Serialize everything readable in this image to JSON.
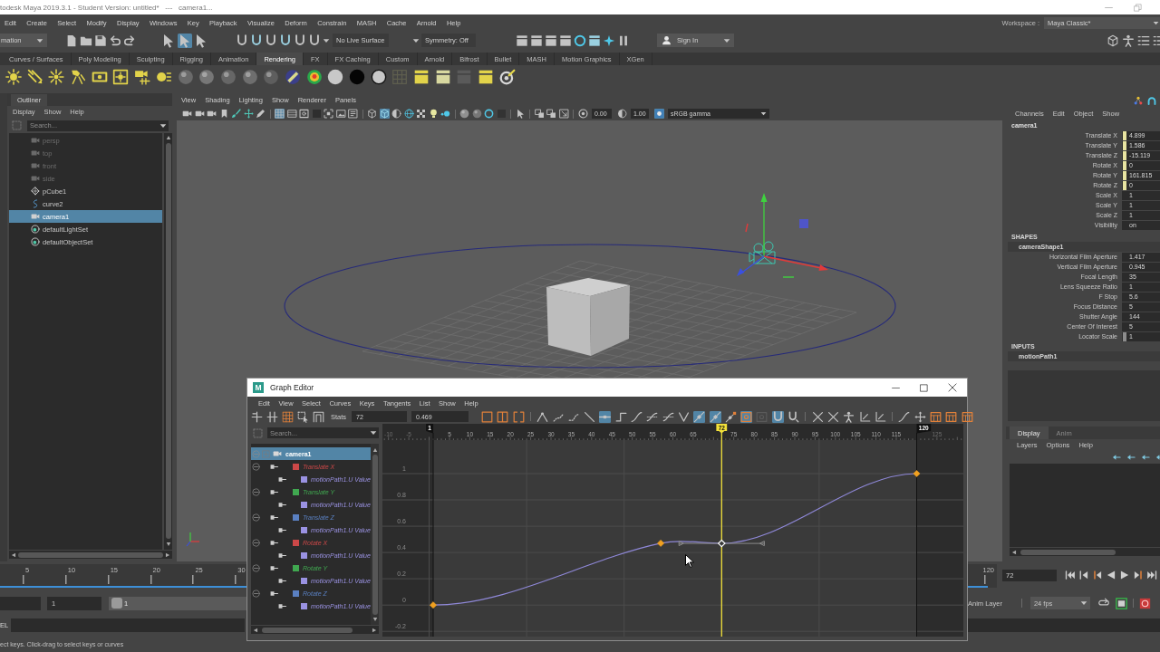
{
  "title_bar": {
    "title": "todesk Maya 2019.3.1 - Student Version: untitled*   ---   camera1..."
  },
  "menu_bar": {
    "items": [
      "Edit",
      "Create",
      "Select",
      "Modify",
      "Display",
      "Windows",
      "Key",
      "Playback",
      "Visualize",
      "Deform",
      "Constrain",
      "MASH",
      "Cache",
      "Arnold",
      "Help"
    ],
    "workspace_label": "Workspace :",
    "workspace": "Maya Classic*"
  },
  "status_line": {
    "menu_set": "mation",
    "select_modes": [
      {
        "on": false
      },
      {
        "on": true
      },
      {
        "on": false
      }
    ],
    "live_surface": "No Live Surface",
    "symmetry": "Symmetry: Off",
    "sign_in": "Sign In"
  },
  "shelf": {
    "tabs": [
      {
        "label": "Curves / Surfaces",
        "selected": false
      },
      {
        "label": "Poly Modeling",
        "selected": false
      },
      {
        "label": "Sculpting",
        "selected": false
      },
      {
        "label": "Rigging",
        "selected": false
      },
      {
        "label": "Animation",
        "selected": false
      },
      {
        "label": "Rendering",
        "selected": true
      },
      {
        "label": "FX",
        "selected": false
      },
      {
        "label": "FX Caching",
        "selected": false
      },
      {
        "label": "Custom",
        "selected": false
      },
      {
        "label": "Arnold",
        "selected": false
      },
      {
        "label": "Bifrost",
        "selected": false
      },
      {
        "label": "Bullet",
        "selected": false
      },
      {
        "label": "MASH",
        "selected": false
      },
      {
        "label": "Motion Graphics",
        "selected": false
      },
      {
        "label": "XGen",
        "selected": false
      }
    ]
  },
  "outliner": {
    "title": "Outliner",
    "menu": [
      "Display",
      "Show",
      "Help"
    ],
    "search": {
      "placeholder": "Search..."
    },
    "items": [
      {
        "label": "persp",
        "kind": "camera",
        "dimmed": true,
        "selected": false
      },
      {
        "label": "top",
        "kind": "camera",
        "dimmed": true,
        "selected": false
      },
      {
        "label": "front",
        "kind": "camera",
        "dimmed": true,
        "selected": false
      },
      {
        "label": "side",
        "kind": "camera",
        "dimmed": true,
        "selected": false
      },
      {
        "label": "pCube1",
        "kind": "mesh",
        "dimmed": false,
        "selected": false
      },
      {
        "label": "curve2",
        "kind": "curve",
        "dimmed": false,
        "selected": false
      },
      {
        "label": "camera1",
        "kind": "camera",
        "dimmed": false,
        "selected": true
      },
      {
        "label": "defaultLightSet",
        "kind": "set",
        "dimmed": false,
        "selected": false
      },
      {
        "label": "defaultObjectSet",
        "kind": "set",
        "dimmed": false,
        "selected": false
      }
    ]
  },
  "viewport": {
    "menu": [
      "View",
      "Shading",
      "Lighting",
      "Show",
      "Renderer",
      "Panels"
    ],
    "tool_buttons": [
      {
        "on": false
      },
      {
        "on": false
      },
      {
        "on": false
      },
      {
        "on": false
      },
      {
        "on": false
      },
      {
        "on": false
      },
      {
        "on": false
      },
      {
        "on": true
      },
      {
        "on": false
      },
      {
        "on": false
      },
      {
        "on": false
      },
      {
        "on": false
      },
      {
        "on": false
      },
      {
        "on": false
      },
      {
        "on": false
      },
      {
        "on": true
      },
      {
        "on": false
      },
      {
        "on": false
      },
      {
        "on": false
      },
      {
        "on": false
      },
      {
        "on": false
      },
      {
        "on": false
      },
      {
        "on": false
      },
      {
        "on": false
      },
      {
        "on": false
      },
      {
        "on": false
      },
      {
        "on": false
      },
      {
        "on": false
      },
      {
        "on": false
      },
      {
        "on": false
      },
      {
        "on": false
      },
      {
        "on": true
      }
    ],
    "exposure": "0.00",
    "gamma": "1.00",
    "color_space": "sRGB gamma"
  },
  "channel_box": {
    "menu": [
      "Channels",
      "Edit",
      "Object",
      "Show"
    ],
    "object": "camera1",
    "channels": [
      {
        "name": "Translate X",
        "value": "4.899",
        "color": "#e8e4a0"
      },
      {
        "name": "Translate Y",
        "value": "1.586",
        "color": "#e8e4a0"
      },
      {
        "name": "Translate Z",
        "value": "-15.119",
        "color": "#e8e4a0"
      },
      {
        "name": "Rotate X",
        "value": "0",
        "color": "#e8e4a0"
      },
      {
        "name": "Rotate Y",
        "value": "161.815",
        "color": "#e8e4a0"
      },
      {
        "name": "Rotate Z",
        "value": "0",
        "color": "#e8e4a0"
      },
      {
        "name": "Scale X",
        "value": "1"
      },
      {
        "name": "Scale Y",
        "value": "1"
      },
      {
        "name": "Scale Z",
        "value": "1"
      },
      {
        "name": "Visibility",
        "value": "on"
      }
    ],
    "shapes_heading": "SHAPES",
    "shape": "cameraShape1",
    "shape_channels": [
      {
        "name": "Horizontal Film Aperture",
        "value": "1.417"
      },
      {
        "name": "Vertical Film Aperture",
        "value": "0.945"
      },
      {
        "name": "Focal Length",
        "value": "35"
      },
      {
        "name": "Lens Squeeze Ratio",
        "value": "1"
      },
      {
        "name": "F Stop",
        "value": "5.6"
      },
      {
        "name": "Focus Distance",
        "value": "5"
      },
      {
        "name": "Shutter Angle",
        "value": "144"
      },
      {
        "name": "Center Of Interest",
        "value": "5"
      },
      {
        "name": "Locator Scale",
        "value": "1",
        "color": "#8c8c8c"
      }
    ],
    "inputs_heading": "INPUTS",
    "input": "motionPath1"
  },
  "layer_editor": {
    "tabs": [
      {
        "label": "Display",
        "selected": true
      },
      {
        "label": "Anim",
        "selected": false
      }
    ],
    "menu": [
      "Layers",
      "Options",
      "Help"
    ]
  },
  "time_slider": {
    "tick_labels": [
      "5",
      "10",
      "15",
      "20",
      "25",
      "30"
    ],
    "end_label": "120",
    "current_time": "72"
  },
  "range_slider": {
    "start": "1",
    "playback_start": "1",
    "anim_layer": "Anim Layer",
    "fps": "24 fps"
  },
  "command_line": {
    "language": "EL"
  },
  "help_line": {
    "text": "ect keys. Click-drag to select keys or curves"
  },
  "graph_editor": {
    "logo": "M",
    "title": "Graph Editor",
    "menu": [
      "Edit",
      "View",
      "Select",
      "Curves",
      "Keys",
      "Tangents",
      "List",
      "Show",
      "Help"
    ],
    "stats_label": "Stats",
    "stats_frame": "72",
    "stats_value": "0.469",
    "tool_buttons": [
      {
        "on": false
      },
      {
        "on": false
      },
      {
        "on": false
      },
      {
        "on": false
      },
      {
        "on": false
      },
      {
        "on": false
      },
      {
        "on": false
      },
      {
        "on": true
      },
      {
        "on": false
      },
      {
        "on": false
      },
      {
        "on": false
      },
      {
        "on": false
      },
      {
        "on": false
      },
      {
        "on": true
      },
      {
        "on": true
      },
      {
        "on": false
      },
      {
        "on": true
      },
      {
        "on": false
      },
      {
        "on": true
      },
      {
        "on": false
      },
      {
        "on": false
      },
      {
        "on": false
      },
      {
        "on": false
      },
      {
        "on": false
      },
      {
        "on": false
      },
      {
        "on": false
      },
      {
        "on": false
      },
      {
        "on": false
      },
      {
        "on": false
      },
      {
        "on": false
      }
    ],
    "search": {
      "placeholder": "Search..."
    },
    "tree": [
      {
        "label": "camera1",
        "selected": true,
        "expanded": true,
        "children": [
          {
            "label": "Translate X",
            "color": "#cc4848",
            "selected": false,
            "expanded": true,
            "children": [
              {
                "label": "motionPath1.U Value",
                "color": "#9a92e2",
                "selected": false
              }
            ]
          },
          {
            "label": "Translate Y",
            "color": "#40a850",
            "selected": false,
            "expanded": true,
            "children": [
              {
                "label": "motionPath1.U Value",
                "color": "#9a92e2",
                "selected": false
              }
            ]
          },
          {
            "label": "Translate Z",
            "color": "#5a80c2",
            "selected": false,
            "expanded": true,
            "children": [
              {
                "label": "motionPath1.U Value",
                "color": "#9a92e2",
                "selected": false
              }
            ]
          },
          {
            "label": "Rotate X",
            "color": "#cc4848",
            "selected": false,
            "expanded": true,
            "children": [
              {
                "label": "motionPath1.U Value",
                "color": "#9a92e2",
                "selected": false
              }
            ]
          },
          {
            "label": "Rotate Y",
            "color": "#40a850",
            "selected": false,
            "expanded": true,
            "children": [
              {
                "label": "motionPath1.U Value",
                "color": "#9a92e2",
                "selected": false
              }
            ]
          },
          {
            "label": "Rotate Z",
            "color": "#5a80c2",
            "selected": false,
            "expanded": true,
            "children": [
              {
                "label": "motionPath1.U Value",
                "color": "#9a92e2",
                "selected": false
              }
            ]
          }
        ]
      }
    ],
    "chart_data": {
      "type": "line",
      "series": [
        {
          "color": "#8f88d8",
          "x": [
            1,
            57,
            72,
            120
          ],
          "values": [
            0,
            0.47,
            0.469,
            1
          ]
        },
        {
          "type": "scatter",
          "color": "#f0a020",
          "marker": "diamond",
          "x": [
            1,
            57,
            120
          ],
          "values": [
            0,
            0.47,
            1
          ]
        },
        {
          "type": "scatter",
          "color": "#ffffff",
          "marker": "diamond",
          "x": [
            72
          ],
          "values": [
            0.469
          ],
          "xerrors": [
            10.5
          ]
        }
      ],
      "xlim": [
        -11.5,
        131.5
      ],
      "ylim": [
        -0.24,
        1.255
      ],
      "xticks": [
        -10,
        -5,
        5,
        10,
        15,
        20,
        25,
        30,
        35,
        40,
        45,
        50,
        55,
        60,
        65,
        75,
        80,
        85,
        90,
        95,
        100,
        105,
        110,
        115,
        125
      ],
      "yticks": [
        -0.2,
        0,
        0.2,
        0.4,
        0.6,
        0.8,
        1
      ],
      "grid": true,
      "ref_lines": [
        {
          "axis": "x",
          "value": 1,
          "label": "1",
          "color": "#111111"
        },
        {
          "axis": "x",
          "value": 72,
          "label": "72",
          "color": "#f2e13a"
        },
        {
          "axis": "x",
          "value": 120,
          "label": "120",
          "color": "#111111"
        }
      ],
      "bands": [
        {
          "axis": "x",
          "from": -11.5,
          "to": 1,
          "color": "#2c2c2c"
        },
        {
          "axis": "x",
          "from": 120,
          "to": 131.5,
          "color": "#2c2c2c"
        }
      ]
    }
  }
}
